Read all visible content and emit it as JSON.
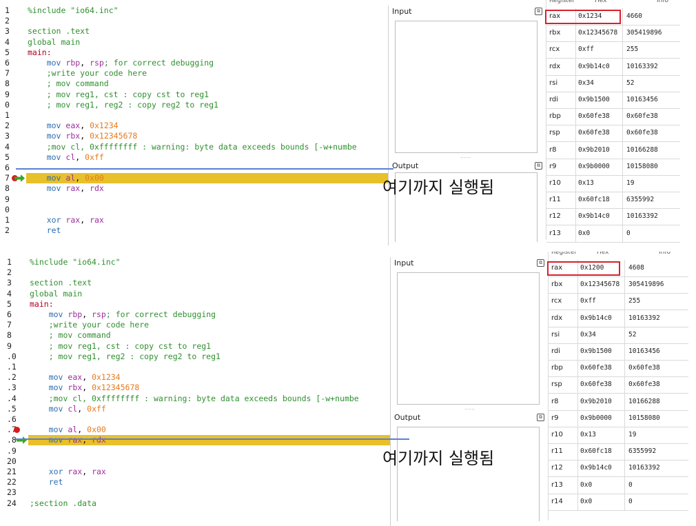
{
  "annotation_text": "여기까지 실행됨",
  "io": {
    "input_label": "Input",
    "output_label": "Output"
  },
  "reg_header": {
    "register": "Register",
    "hex": "Hex",
    "info": "Info"
  },
  "top": {
    "line_numbers": [
      "1",
      "2",
      "3",
      "4",
      "5",
      "6",
      "7",
      "8",
      "9",
      "0",
      "1",
      "2",
      "3",
      "4",
      "5",
      "6",
      "7",
      "8",
      "9",
      "0",
      "1",
      "2"
    ],
    "code": [
      "%include \"io64.inc\"",
      "",
      "section .text",
      "global main",
      "main:",
      "    mov rbp, rsp; for correct debugging",
      "    ;write your code here",
      "    ; mov command",
      "    ; mov reg1, cst : copy cst to reg1",
      "    ; mov reg1, reg2 : copy reg2 to reg1",
      "",
      "    mov eax, 0x1234",
      "    mov rbx, 0x12345678",
      "    ;mov cl, 0xffffffff : warning: byte data exceeds bounds [-w+numbe",
      "    mov cl, 0xff",
      "",
      "    mov al, 0x00",
      "    mov rax, rdx",
      "",
      "",
      "    xor rax, rax",
      "    ret"
    ],
    "registers": [
      {
        "name": "rax",
        "hex": "0x1234",
        "info": "4660"
      },
      {
        "name": "rbx",
        "hex": "0x12345678",
        "info": "305419896"
      },
      {
        "name": "rcx",
        "hex": "0xff",
        "info": "255"
      },
      {
        "name": "rdx",
        "hex": "0x9b14c0",
        "info": "10163392"
      },
      {
        "name": "rsi",
        "hex": "0x34",
        "info": "52"
      },
      {
        "name": "rdi",
        "hex": "0x9b1500",
        "info": "10163456"
      },
      {
        "name": "rbp",
        "hex": "0x60fe38",
        "info": "0x60fe38"
      },
      {
        "name": "rsp",
        "hex": "0x60fe38",
        "info": "0x60fe38"
      },
      {
        "name": "r8",
        "hex": "0x9b2010",
        "info": "10166288"
      },
      {
        "name": "r9",
        "hex": "0x9b0000",
        "info": "10158080"
      },
      {
        "name": "r10",
        "hex": "0x13",
        "info": "19"
      },
      {
        "name": "r11",
        "hex": "0x60fc18",
        "info": "6355992"
      },
      {
        "name": "r12",
        "hex": "0x9b14c0",
        "info": "10163392"
      },
      {
        "name": "r13",
        "hex": "0x0",
        "info": "0"
      }
    ]
  },
  "bottom": {
    "line_numbers": [
      "1",
      "2",
      "3",
      "4",
      "5",
      "6",
      "7",
      "8",
      "9",
      ".0",
      ".1",
      ".2",
      ".3",
      ".4",
      ".5",
      ".6",
      ".7",
      ".8",
      ".9",
      "20",
      "21",
      "22",
      "23",
      "24"
    ],
    "code": [
      "%include \"io64.inc\"",
      "",
      "section .text",
      "global main",
      "main:",
      "    mov rbp, rsp; for correct debugging",
      "    ;write your code here",
      "    ; mov command",
      "    ; mov reg1, cst : copy cst to reg1",
      "    ; mov reg1, reg2 : copy reg2 to reg1",
      "",
      "    mov eax, 0x1234",
      "    mov rbx, 0x12345678",
      "    ;mov cl, 0xffffffff : warning: byte data exceeds bounds [-w+numbe",
      "    mov cl, 0xff",
      "",
      "    mov al, 0x00",
      "    mov rax, rdx",
      "",
      "",
      "    xor rax, rax",
      "    ret",
      "",
      ";section .data"
    ],
    "registers": [
      {
        "name": "rax",
        "hex": "0x1200",
        "info": "4608"
      },
      {
        "name": "rbx",
        "hex": "0x12345678",
        "info": "305419896"
      },
      {
        "name": "rcx",
        "hex": "0xff",
        "info": "255"
      },
      {
        "name": "rdx",
        "hex": "0x9b14c0",
        "info": "10163392"
      },
      {
        "name": "rsi",
        "hex": "0x34",
        "info": "52"
      },
      {
        "name": "rdi",
        "hex": "0x9b1500",
        "info": "10163456"
      },
      {
        "name": "rbp",
        "hex": "0x60fe38",
        "info": "0x60fe38"
      },
      {
        "name": "rsp",
        "hex": "0x60fe38",
        "info": "0x60fe38"
      },
      {
        "name": "r8",
        "hex": "0x9b2010",
        "info": "10166288"
      },
      {
        "name": "r9",
        "hex": "0x9b0000",
        "info": "10158080"
      },
      {
        "name": "r10",
        "hex": "0x13",
        "info": "19"
      },
      {
        "name": "r11",
        "hex": "0x60fc18",
        "info": "6355992"
      },
      {
        "name": "r12",
        "hex": "0x9b14c0",
        "info": "10163392"
      },
      {
        "name": "r13",
        "hex": "0x0",
        "info": "0"
      },
      {
        "name": "r14",
        "hex": "0x0",
        "info": "0"
      }
    ]
  },
  "colors": {
    "highlight": "#e8c02a",
    "breakpoint": "#d81b1b",
    "marker_line": "#5b7fd1",
    "redbox": "#d6202a"
  }
}
